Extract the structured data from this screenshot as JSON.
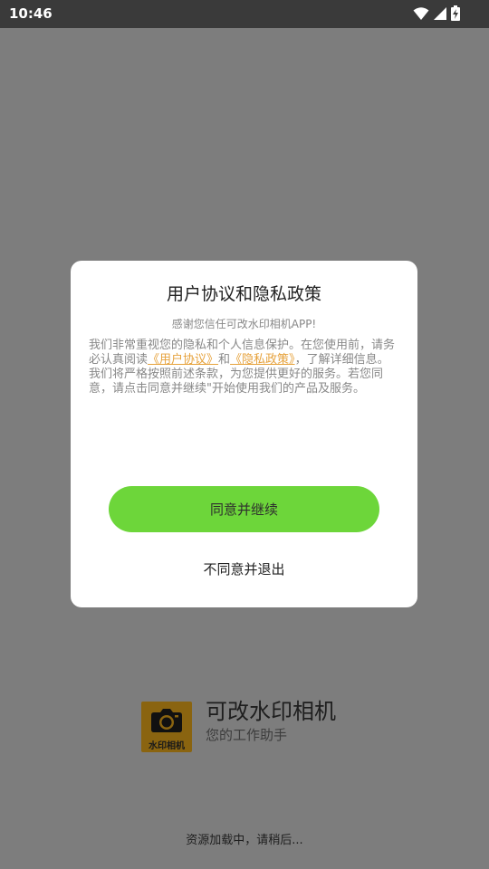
{
  "status_bar": {
    "time": "10:46",
    "icons": [
      "wifi-icon",
      "signal-icon",
      "battery-charging-icon"
    ]
  },
  "dialog": {
    "title": "用户协议和隐私政策",
    "subtitle": "感谢您信任可改水印相机APP!",
    "body": {
      "part1": "我们非常重视您的隐私和个人信息保护。在您使用前，请务必认真阅读",
      "link1": "《用户协议》",
      "part2": "和",
      "link2": "《隐私政策》",
      "part3": "，了解详细信息。我们将严格按照前述条款，为您提供更好的服务。若您同意，请点击同意并继续\"开始使用我们的产品及服务。"
    },
    "agree_label": "同意并继续",
    "disagree_label": "不同意并退出"
  },
  "splash": {
    "logo_text": "水印相机",
    "app_name": "可改水印相机",
    "tagline": "您的工作助手",
    "loading": "资源加载中，请稍后..."
  },
  "colors": {
    "accent": "#6dd63a",
    "link": "#e6a23c",
    "overlay": "#7d7d7d",
    "status_bar": "#3a3a3a"
  }
}
